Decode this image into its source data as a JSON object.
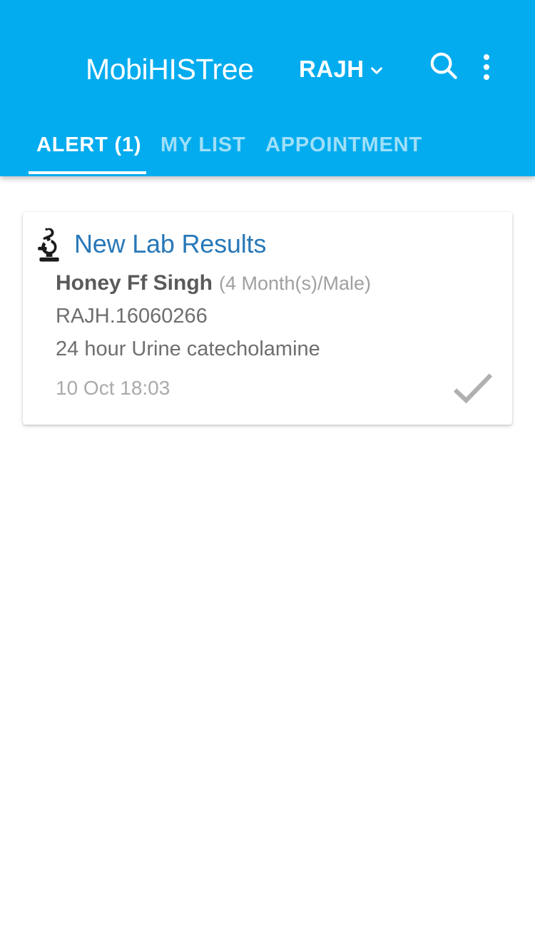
{
  "appbar": {
    "title": "MobiHISTree",
    "org": "RAJH",
    "org_dropdown_icon": "chevron-down-icon",
    "search_icon": "search-icon",
    "overflow_icon": "more-vertical-icon",
    "background_color": "#03ACEE",
    "text_color": "#FFFFFF"
  },
  "tabs": [
    {
      "label": "ALERT (1)",
      "active": true
    },
    {
      "label": "MY LIST",
      "active": false
    },
    {
      "label": "APPOINTMENT",
      "active": false
    }
  ],
  "alerts": [
    {
      "icon": "microscope-icon",
      "title": "New Lab Results",
      "title_color": "#2878B8",
      "patient_name": "Honey Ff Singh",
      "patient_demographics": "(4 Month(s)/Male)",
      "mrn": "RAJH.16060266",
      "test_name": "24 hour Urine catecholamine",
      "timestamp": "10 Oct 18:03",
      "acknowledge_icon": "check-icon"
    }
  ]
}
